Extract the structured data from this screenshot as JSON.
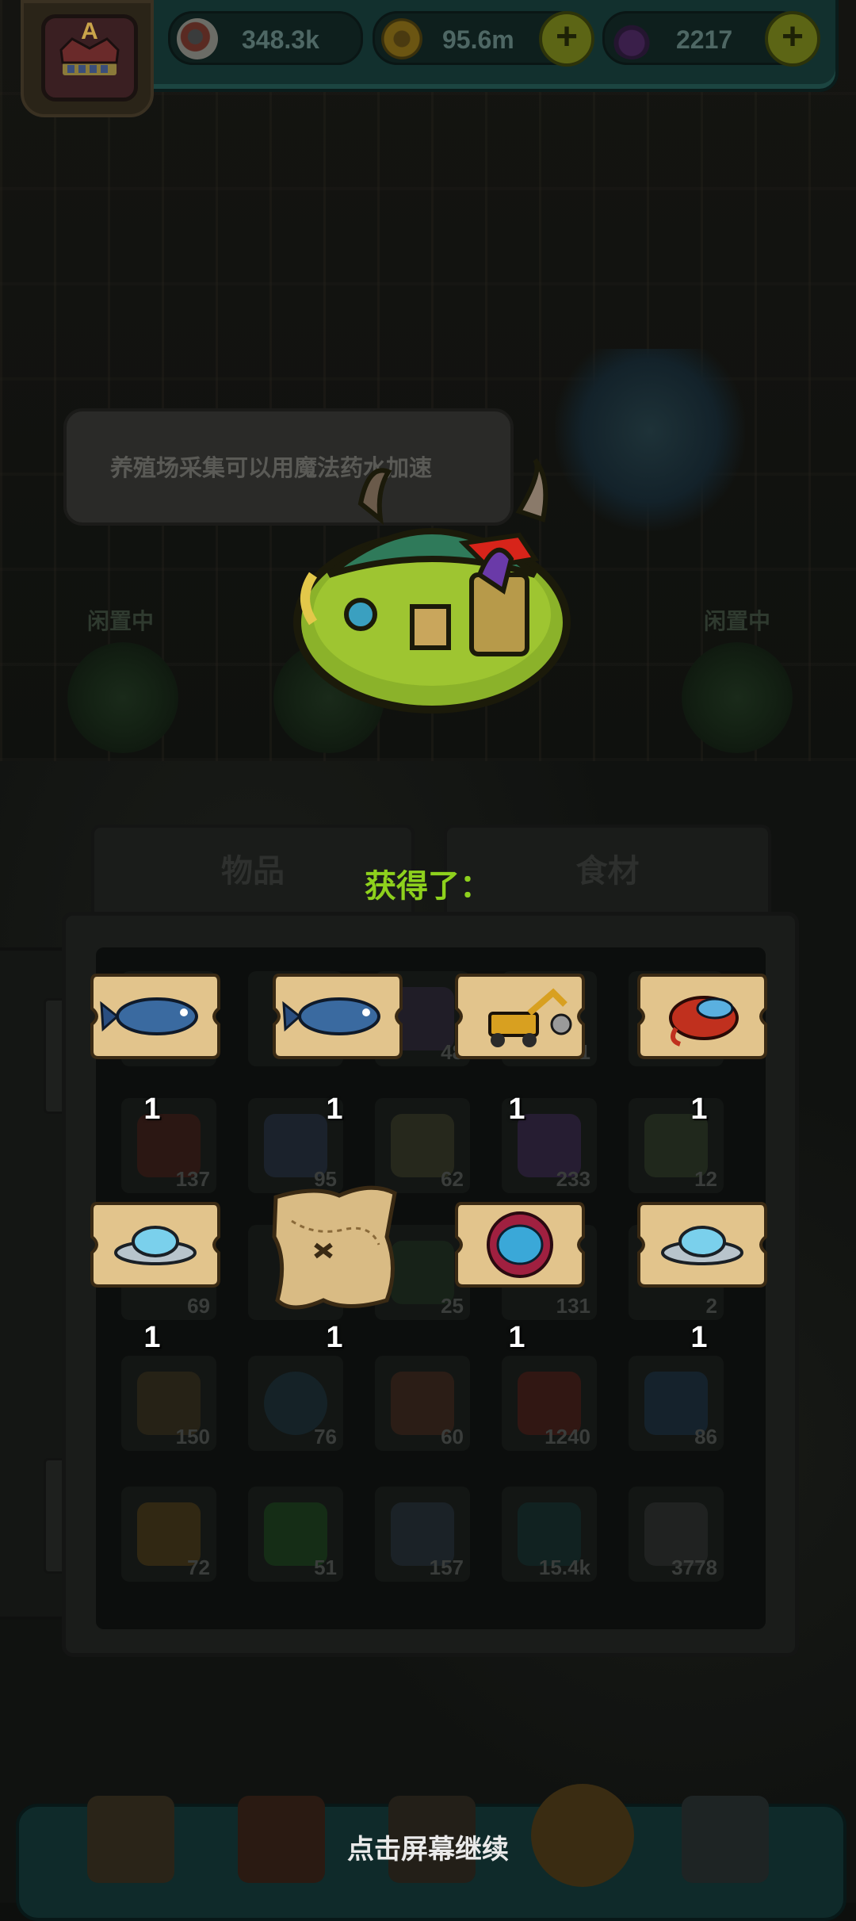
{
  "resources": {
    "eyeballs": "348.3k",
    "coins": "95.6m",
    "potions": "2217",
    "plus_symbol": "+"
  },
  "avatar": {
    "rank": "A"
  },
  "speech": {
    "text": "养殖场采集可以用魔法药水加速"
  },
  "farm": {
    "left_status": "闲置中",
    "right_status": "闲置中"
  },
  "panel": {
    "tabs": [
      {
        "label": "物品"
      },
      {
        "label": "食材"
      }
    ],
    "gain_title": "获得了：",
    "inventory_counts": [
      "",
      "",
      "48",
      "1",
      "",
      "",
      "137",
      "95",
      "62",
      "233",
      "12",
      "69",
      "",
      "25",
      "131",
      "2",
      "150",
      "76",
      "60",
      "1240",
      "86",
      "72",
      "51",
      "157",
      "15.4k",
      "3778"
    ],
    "rewards": [
      {
        "name": "blue-fish-ticket",
        "qty": "1"
      },
      {
        "name": "blue-fish-ticket",
        "qty": "1"
      },
      {
        "name": "excavator-ticket",
        "qty": "1"
      },
      {
        "name": "red-squid-ticket",
        "qty": "1"
      },
      {
        "name": "ufo-ticket",
        "qty": "1"
      },
      {
        "name": "treasure-map",
        "qty": "1"
      },
      {
        "name": "octopus-egg-ticket",
        "qty": "1"
      },
      {
        "name": "ufo-ticket",
        "qty": "1"
      }
    ]
  },
  "footer": {
    "continue_text": "点击屏幕继续"
  },
  "colors": {
    "accent_green": "#8ed11d",
    "panel_dark": "#0c0e0d"
  }
}
